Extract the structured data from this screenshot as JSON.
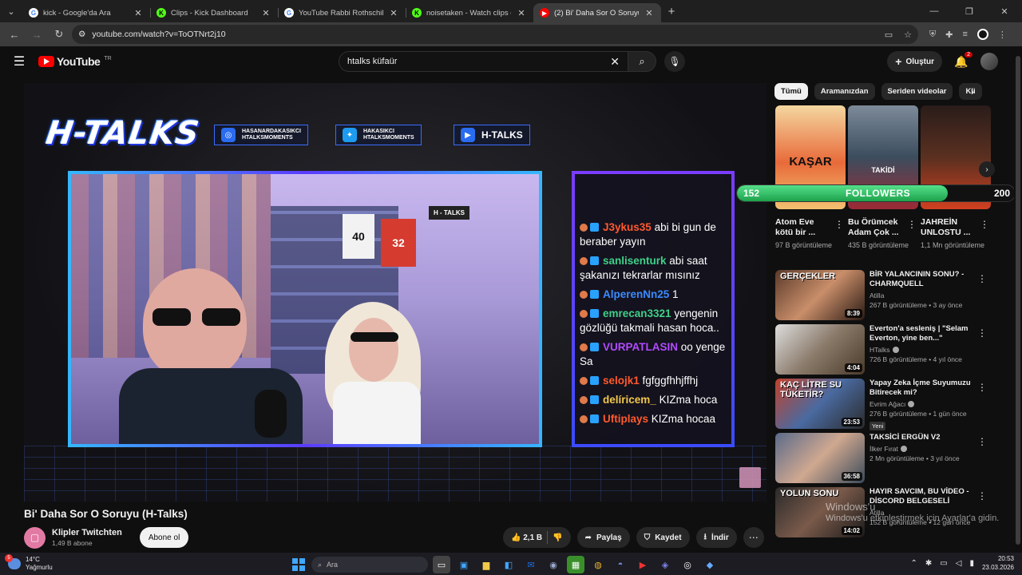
{
  "browser": {
    "tabs": [
      {
        "title": "kick - Google'da Ara",
        "favicon": "google-icon",
        "active": false
      },
      {
        "title": "Clips - Kick Dashboard",
        "favicon": "kick-icon",
        "active": false
      },
      {
        "title": "YouTube Rabbi Rothschild - Go",
        "favicon": "google-icon",
        "active": false
      },
      {
        "title": "noisetaken - Watch clips on Kic",
        "favicon": "kick-icon",
        "active": false
      },
      {
        "title": "(2) Bi' Daha Sor O Soruyu (H-Ta",
        "favicon": "youtube-icon",
        "active": true
      }
    ],
    "url": "youtube.com/watch?v=ToOTNrt2j10"
  },
  "masthead": {
    "logo_text": "YouTube",
    "country_code": "TR",
    "search_query": "htalks küfaür",
    "create_label": "Oluştur",
    "notification_count": "2"
  },
  "video": {
    "title": "Bi' Daha Sor O Soruyu (H-Talks)",
    "overlay": {
      "logo": "H-TALKS",
      "socials": [
        {
          "icon": "instagram-icon",
          "lines": [
            "HASANARDAKASIKCI",
            "HTALKSMOMENTS"
          ],
          "color": "#2a6cf0"
        },
        {
          "icon": "twitter-icon",
          "lines": [
            "HAKASIKCI",
            "HTALKSMOMENTS"
          ],
          "color": "#1d9bf0"
        },
        {
          "icon": "youtube-icon",
          "lines": [
            "H-TALKS"
          ],
          "color": "#2a6cf0"
        }
      ],
      "room_jersey_1": "40",
      "room_jersey_2": "32",
      "room_sign": "H - TALKS",
      "chat": [
        {
          "user": "J3ykus35",
          "user_color": "#ff5a2e",
          "text": "abi bi gun de beraber yayın"
        },
        {
          "user": "sanlisenturk",
          "user_color": "#3fd08a",
          "text": "abi saat şakanızı tekrarlar mısınız"
        },
        {
          "user": "AlperenNn25",
          "user_color": "#3a8bff",
          "text": "1"
        },
        {
          "user": "emrecan3321",
          "user_color": "#3fd08a",
          "text": "yengenin gözlüğü takmali hasan hoca.."
        },
        {
          "user": "VURPATLASIN",
          "user_color": "#b04bff",
          "text": "oo yenge Sa"
        },
        {
          "user": "selojk1",
          "user_color": "#ff5a2e",
          "text": "fgfggfhhjffhj"
        },
        {
          "user": "delíricem_",
          "user_color": "#f2c84b",
          "text": "KIZma hoca"
        },
        {
          "user": "Uftiplays",
          "user_color": "#ff5a2e",
          "text": "KIZma hocaa"
        }
      ]
    },
    "channel": {
      "name": "Klipler Twitchten",
      "subscribers": "1,49 B abone",
      "subscribe_label": "Abone ol"
    },
    "actions": {
      "likes": "2,1 B",
      "share": "Paylaş",
      "save": "Kaydet",
      "download": "İndir"
    }
  },
  "sidebar": {
    "chips": [
      "Tümü",
      "Aramanızdan",
      "Seriden videolar",
      "Kli"
    ],
    "shorts": [
      {
        "title": "Atom Eve kötü bir ...",
        "views": "97 B görüntüleme",
        "thumb_text": "KAŞAR"
      },
      {
        "title": "Bu Örümcek Adam Çok ...",
        "views": "435 B görüntüleme",
        "thumb_text": "TAKİDİ"
      },
      {
        "title": "JAHREİN UNLOSTU ...",
        "views": "1,1 Mn görüntüleme",
        "thumb_text": ""
      }
    ],
    "followers_widget": {
      "current": "152",
      "label": "FOLLOWERS",
      "goal": "200",
      "progress": 0.76
    },
    "recommendations": [
      {
        "title": "BİR YALANCININ SONU? - CHARMQUELL",
        "channel": "Atilla",
        "verified": false,
        "stats": "267 B görüntüleme • 3 ay önce",
        "duration": "8:39",
        "thumb_overlay": "GERÇEKLER",
        "new": ""
      },
      {
        "title": "Everton'a sesleniş | \"Selam Everton, yine ben...\"",
        "channel": "HTalks",
        "verified": true,
        "stats": "726 B görüntüleme • 4 yıl önce",
        "duration": "4:04",
        "thumb_overlay": "",
        "new": ""
      },
      {
        "title": "Yapay Zeka İçme Suyumuzu Bitirecek mi?",
        "channel": "Evrim Ağacı",
        "verified": true,
        "stats": "276 B görüntüleme • 1 gün önce",
        "duration": "23:53",
        "thumb_overlay": "KAÇ LİTRE SU TÜKETİR?",
        "new": "Yeni"
      },
      {
        "title": "TAKSİCİ ERGÜN V2",
        "channel": "İlker Fırat",
        "verified": true,
        "stats": "2 Mn görüntüleme • 3 yıl önce",
        "duration": "36:58",
        "thumb_overlay": "",
        "new": ""
      },
      {
        "title": "HAYIR SAVCIM, BU VİDEO - DİSCORD BELGESELİ",
        "channel": "Atilla",
        "verified": false,
        "stats": "152 B görüntüleme • 12 gün önce",
        "duration": "14:02",
        "thumb_overlay": "YOLUN SONU",
        "new": ""
      }
    ]
  },
  "windows_watermark": {
    "line1": "Windows'u",
    "line2": "Windows'u etkinleştirmek için Ayarlar'a gidin."
  },
  "taskbar": {
    "weather_temp": "14°C",
    "weather_desc": "Yağmurlu",
    "weather_badge": "5",
    "search_placeholder": "Ara",
    "time": "20:53",
    "date": "23.03.2026"
  }
}
